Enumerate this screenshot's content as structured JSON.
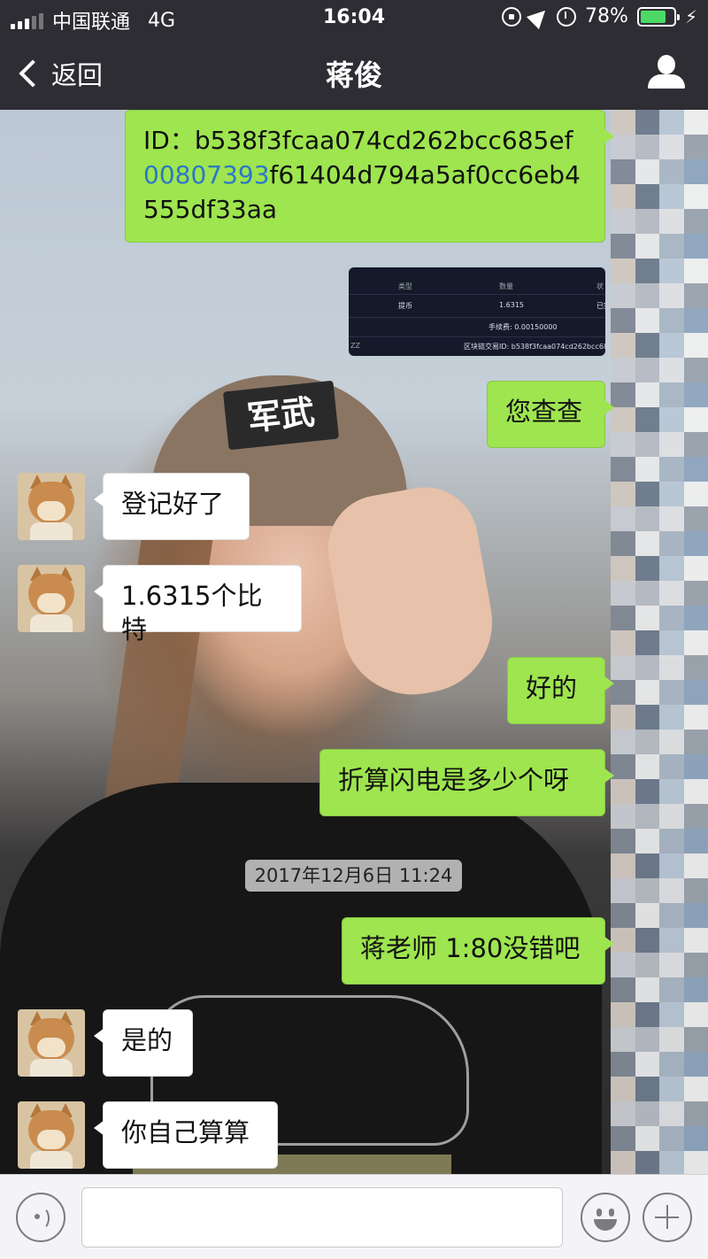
{
  "status_bar": {
    "carrier": "中国联通",
    "network": "4G",
    "time": "16:04",
    "battery": "78%",
    "battery_level": 0.78,
    "icons": [
      "signal-icon",
      "rotation-lock-icon",
      "location-icon",
      "alarm-icon",
      "battery-icon",
      "charging-icon"
    ]
  },
  "nav": {
    "back_label": "返回",
    "title": "蒋俊",
    "right_icon": "profile-icon"
  },
  "messages": [
    {
      "id": "m1",
      "direction": "out",
      "type": "text",
      "text_prefix": "ID：b538f3fcaa074cd262bcc685ef",
      "text_link": "00807393",
      "text_suffix": "f61404d794a5af0cc6eb4555df33aa"
    },
    {
      "id": "m2",
      "direction": "out",
      "type": "image",
      "image": {
        "col1": "类型",
        "col2": "数量",
        "col3": "状",
        "r1c1": "提币",
        "r1c2": "1.6315",
        "r1c3": "已完",
        "r2": "手续费: 0.00150000",
        "r3_left": "ZZ",
        "r3": "区块链交易ID: b538f3fcaa074cd262bcc685"
      }
    },
    {
      "id": "m3",
      "direction": "out",
      "type": "text",
      "text": "您查查"
    },
    {
      "id": "m4",
      "direction": "in",
      "type": "text",
      "text": "登记好了"
    },
    {
      "id": "m5",
      "direction": "in",
      "type": "text",
      "text": "1.6315个比特"
    },
    {
      "id": "m6",
      "direction": "out",
      "type": "text",
      "text": "好的"
    },
    {
      "id": "m7",
      "direction": "out",
      "type": "text",
      "text": "折算闪电是多少个呀"
    },
    {
      "id": "m8",
      "direction": "out",
      "type": "text",
      "text": "蒋老师 1:80没错吧"
    },
    {
      "id": "m9",
      "direction": "in",
      "type": "text",
      "text": "是的"
    },
    {
      "id": "m10",
      "direction": "in",
      "type": "text",
      "text": "你自己算算"
    }
  ],
  "timestamp": "2017年12月6日 11:24",
  "background": {
    "cap_text": "军武"
  },
  "input_bar": {
    "placeholder": "",
    "left_icon": "voice-icon",
    "right_icons": [
      "emoji-icon",
      "plus-icon"
    ]
  },
  "colors": {
    "bubble_out": "#9ee54f",
    "bubble_in": "#ffffff",
    "nav_bg": "#2e2d33",
    "link": "#2d77c8",
    "battery": "#4cd964"
  }
}
